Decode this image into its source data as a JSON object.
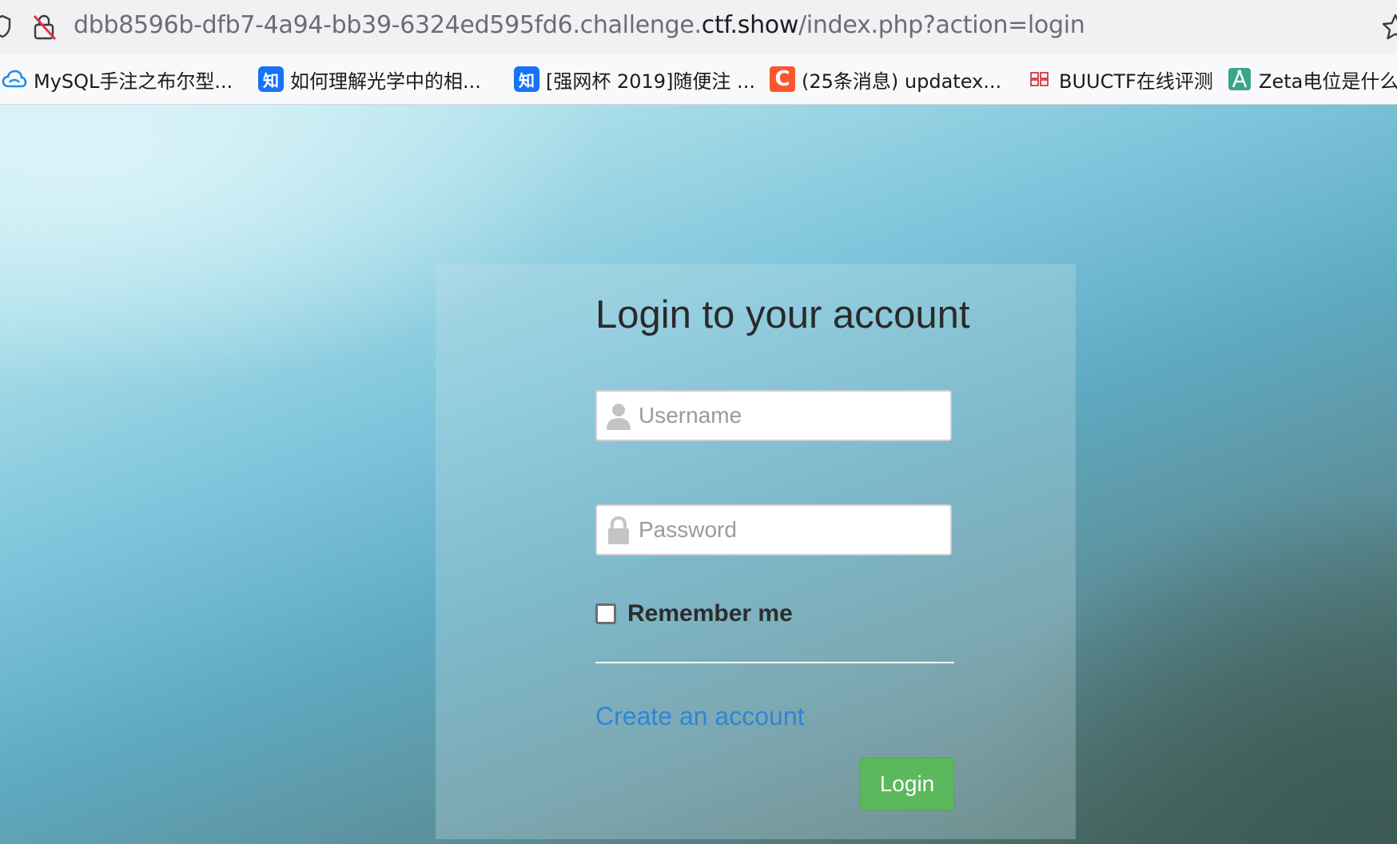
{
  "browser": {
    "url_prefix": "dbb8596b-dfb7-4a94-bb39-6324ed595fd6.challenge.",
    "url_host": "ctf.show",
    "url_path": "/index.php?action=login"
  },
  "bookmarks": [
    {
      "label": "MySQL手注之布尔型...",
      "icon": "cloud-icon"
    },
    {
      "label": "如何理解光学中的相...",
      "icon": "zhihu-icon",
      "icon_text": "知"
    },
    {
      "label": "[强网杯 2019]随便注 ...",
      "icon": "zhihu-icon",
      "icon_text": "知"
    },
    {
      "label": "(25条消息) updatex...",
      "icon": "csdn-icon",
      "icon_text": "C"
    },
    {
      "label": "BUUCTF在线评测",
      "icon": "buuctf-icon"
    },
    {
      "label": "Zeta电位是什么",
      "icon": "compass-icon"
    }
  ],
  "login": {
    "title": "Login to your account",
    "username_placeholder": "Username",
    "password_placeholder": "Password",
    "remember_label": "Remember me",
    "create_account_label": "Create an account",
    "login_button_label": "Login"
  },
  "colors": {
    "login_button": "#5cb85c",
    "link": "#2f86d6",
    "insecure_icon": "#e2334c"
  }
}
